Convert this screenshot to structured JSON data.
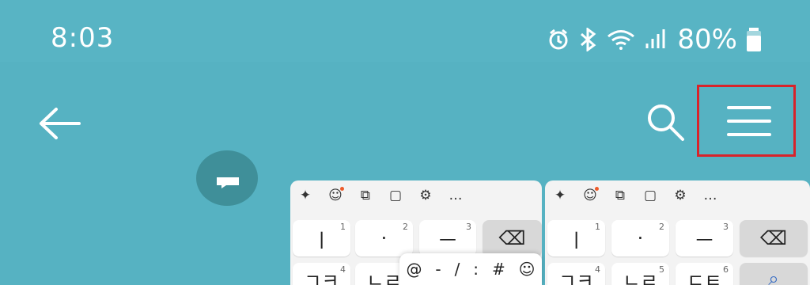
{
  "status": {
    "time": "8:03",
    "battery": "80%",
    "icons": [
      "alarm-icon",
      "bluetooth-icon",
      "wifi-icon",
      "signal-icon",
      "battery-icon"
    ]
  },
  "appbar": {
    "icons": [
      "back-arrow-icon",
      "search-icon",
      "hamburger-menu-icon"
    ],
    "highlight_color": "#d8232a"
  },
  "keyboard": {
    "toolbar": [
      "✦",
      "☺",
      "⧉",
      "▢",
      "⚙",
      "…"
    ],
    "rows": [
      {
        "label": "ㅣ",
        "sub": "1"
      },
      {
        "label": "·",
        "sub": "2"
      },
      {
        "label": "ㅡ",
        "sub": "3"
      }
    ],
    "row2": [
      {
        "label": "ㄱㅋ",
        "sub": "4"
      },
      {
        "label": "ㄴㄹ",
        "sub": "5"
      },
      {
        "label": "ㄷㅌ",
        "sub": "6"
      }
    ],
    "backspace": "⌫",
    "search": "⌕",
    "popup": [
      "@",
      "-",
      "/",
      ":",
      "#",
      "☺"
    ]
  },
  "colors": {
    "background": "#56b2c2",
    "keyboard": "#f3f3f3",
    "accent": "#ee5b2a"
  }
}
